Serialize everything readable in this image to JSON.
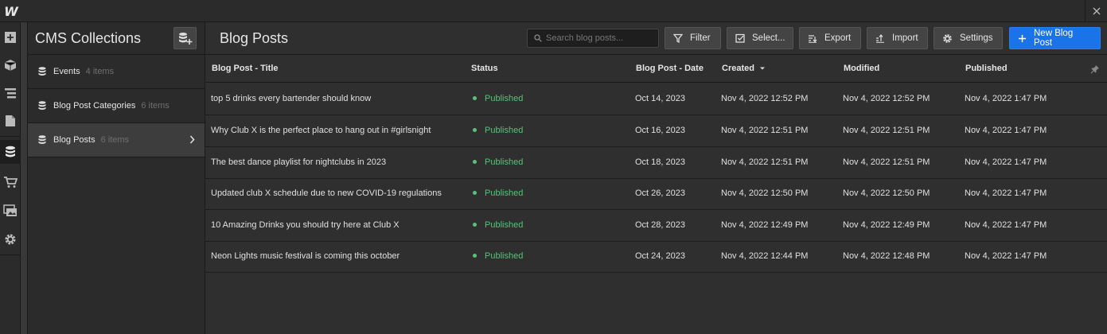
{
  "app": {
    "logo": "W"
  },
  "sidebar": {
    "title": "CMS Collections",
    "items": [
      {
        "label": "Events",
        "count": "4 items"
      },
      {
        "label": "Blog Post Categories",
        "count": "6 items"
      },
      {
        "label": "Blog Posts",
        "count": "6 items"
      }
    ]
  },
  "main": {
    "title": "Blog Posts",
    "search_placeholder": "Search blog posts...",
    "toolbar": {
      "filter": "Filter",
      "select": "Select...",
      "export": "Export",
      "import": "Import",
      "settings": "Settings",
      "new": "New Blog Post"
    }
  },
  "table": {
    "headers": {
      "title": "Blog Post - Title",
      "status": "Status",
      "date": "Blog Post - Date",
      "created": "Created",
      "modified": "Modified",
      "published": "Published"
    },
    "rows": [
      {
        "title": "top 5 drinks every bartender should know",
        "status": "Published",
        "date": "Oct 14, 2023",
        "created": "Nov 4, 2022 12:52 PM",
        "modified": "Nov 4, 2022 12:52 PM",
        "published": "Nov 4, 2022 1:47 PM"
      },
      {
        "title": "Why Club X is the perfect place to hang out in #girlsnight",
        "status": "Published",
        "date": "Oct 16, 2023",
        "created": "Nov 4, 2022 12:51 PM",
        "modified": "Nov 4, 2022 12:51 PM",
        "published": "Nov 4, 2022 1:47 PM"
      },
      {
        "title": "The best dance playlist for nightclubs in 2023",
        "status": "Published",
        "date": "Oct 18, 2023",
        "created": "Nov 4, 2022 12:51 PM",
        "modified": "Nov 4, 2022 12:51 PM",
        "published": "Nov 4, 2022 1:47 PM"
      },
      {
        "title": "Updated club X schedule due to new COVID-19 regulations",
        "status": "Published",
        "date": "Oct 26, 2023",
        "created": "Nov 4, 2022 12:50 PM",
        "modified": "Nov 4, 2022 12:50 PM",
        "published": "Nov 4, 2022 1:47 PM"
      },
      {
        "title": "10 Amazing Drinks you should try here at Club X",
        "status": "Published",
        "date": "Oct 28, 2023",
        "created": "Nov 4, 2022 12:49 PM",
        "modified": "Nov 4, 2022 12:49 PM",
        "published": "Nov 4, 2022 1:47 PM"
      },
      {
        "title": "Neon Lights music festival is coming this october",
        "status": "Published",
        "date": "Oct 24, 2023",
        "created": "Nov 4, 2022 12:44 PM",
        "modified": "Nov 4, 2022 12:48 PM",
        "published": "Nov 4, 2022 1:47 PM"
      }
    ]
  },
  "colors": {
    "accent": "#1a73e8",
    "published": "#55c37a",
    "background": "#2f2f2f"
  }
}
